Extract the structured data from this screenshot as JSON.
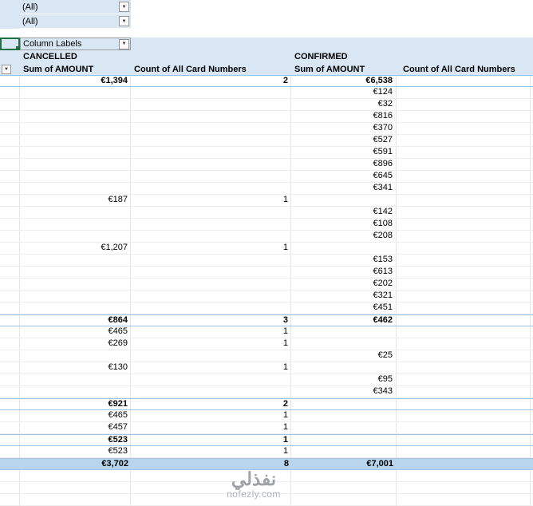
{
  "app": "spreadsheet-pivot-table",
  "icons": {
    "dropdown_arrow": "▼"
  },
  "colors": {
    "header_band": "#d9e7f5",
    "grand_total_bg": "#b9d5eb",
    "total_border": "#9dc3e6",
    "selected_cell_border": "#1f7145"
  },
  "filters": [
    {
      "value": "(All)"
    },
    {
      "value": "(All)"
    }
  ],
  "pivot": {
    "column_labels_label": "Column Labels",
    "groups": [
      {
        "label": "CANCELLED"
      },
      {
        "label": "CONFIRMED"
      }
    ],
    "column_headers": [
      "Sum of AMOUNT",
      "Count of All Card Numbers",
      "Sum of AMOUNT",
      "Count of All Card Numbers"
    ],
    "rows": [
      {
        "cancelled_sum": "€1,394",
        "cancelled_count": "2",
        "confirmed_sum": "€6,538",
        "confirmed_count": "",
        "style": "subtotal"
      },
      {
        "confirmed_sum": "€124"
      },
      {
        "confirmed_sum": "€32"
      },
      {
        "confirmed_sum": "€816"
      },
      {
        "confirmed_sum": "€370"
      },
      {
        "confirmed_sum": "€527"
      },
      {
        "confirmed_sum": "€591"
      },
      {
        "confirmed_sum": "€896"
      },
      {
        "confirmed_sum": "€645"
      },
      {
        "confirmed_sum": "€341"
      },
      {
        "cancelled_sum": "€187",
        "cancelled_count": "1"
      },
      {
        "confirmed_sum": "€142"
      },
      {
        "confirmed_sum": "€108"
      },
      {
        "confirmed_sum": "€208"
      },
      {
        "cancelled_sum": "€1,207",
        "cancelled_count": "1"
      },
      {
        "confirmed_sum": "€153"
      },
      {
        "confirmed_sum": "€613"
      },
      {
        "confirmed_sum": "€202"
      },
      {
        "confirmed_sum": "€321"
      },
      {
        "confirmed_sum": "€451"
      },
      {
        "cancelled_sum": "€864",
        "cancelled_count": "3",
        "confirmed_sum": "€462",
        "confirmed_count": "",
        "style": "subtotal"
      },
      {
        "cancelled_sum": "€465",
        "cancelled_count": "1"
      },
      {
        "cancelled_sum": "€269",
        "cancelled_count": "1"
      },
      {
        "confirmed_sum": "€25"
      },
      {
        "cancelled_sum": "€130",
        "cancelled_count": "1"
      },
      {
        "confirmed_sum": "€95"
      },
      {
        "confirmed_sum": "€343"
      },
      {
        "cancelled_sum": "€921",
        "cancelled_count": "2",
        "style": "subtotal"
      },
      {
        "cancelled_sum": "€465",
        "cancelled_count": "1"
      },
      {
        "cancelled_sum": "€457",
        "cancelled_count": "1"
      },
      {
        "cancelled_sum": "€523",
        "cancelled_count": "1",
        "style": "subtotal"
      },
      {
        "cancelled_sum": "€523",
        "cancelled_count": "1"
      },
      {
        "cancelled_sum": "€3,702",
        "cancelled_count": "8",
        "confirmed_sum": "€7,001",
        "confirmed_count": "",
        "style": "grandtotal"
      },
      {
        "style": "empty"
      },
      {
        "style": "empty"
      },
      {
        "style": "empty"
      }
    ]
  },
  "watermark": {
    "title": "نفذلي",
    "domain": "nofezly.com"
  }
}
